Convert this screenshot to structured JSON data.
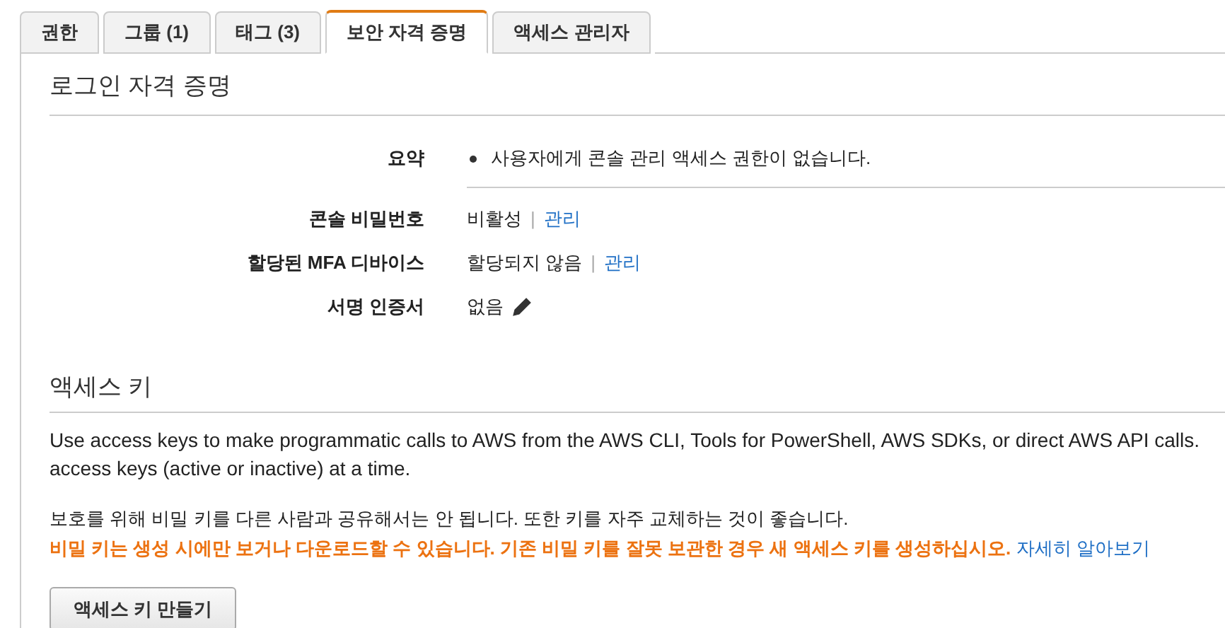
{
  "tabs": [
    {
      "label": "권한",
      "selected": false
    },
    {
      "label": "그룹 (1)",
      "selected": false
    },
    {
      "label": "태그 (3)",
      "selected": false
    },
    {
      "label": "보안 자격 증명",
      "selected": true
    },
    {
      "label": "액세스 관리자",
      "selected": false
    }
  ],
  "sign_in_credentials": {
    "heading": "로그인 자격 증명",
    "summary": {
      "label": "요약",
      "items": [
        "사용자에게 콘솔 관리 액세스 권한이 없습니다."
      ]
    },
    "rows": [
      {
        "kind": "link",
        "label": "콘솔 비밀번호",
        "value": "비활성",
        "separator": "|",
        "link": "관리"
      },
      {
        "kind": "link",
        "label": "할당된 MFA 디바이스",
        "value": "할당되지 않음",
        "separator": "|",
        "link": "관리"
      },
      {
        "kind": "edit",
        "label": "서명 인증서",
        "value": "없음"
      }
    ]
  },
  "access_keys": {
    "heading": "액세스 키",
    "description_lines": [
      "Use access keys to make programmatic calls to AWS from the AWS CLI, Tools for PowerShell, AWS SDKs, or direct AWS API calls.",
      "access keys (active or inactive) at a time."
    ],
    "notice": "보호를 위해 비밀 키를 다른 사람과 공유해서는 안 됩니다. 또한 키를 자주 교체하는 것이 좋습니다.",
    "warning": "비밀 키는 생성 시에만 보거나 다운로드할 수 있습니다. 기존 비밀 키를 잘못 보관한 경우 새 액세스 키를 생성하십시오.",
    "learn_more": "자세히 알아보기",
    "button": "액세스 키 만들기"
  }
}
